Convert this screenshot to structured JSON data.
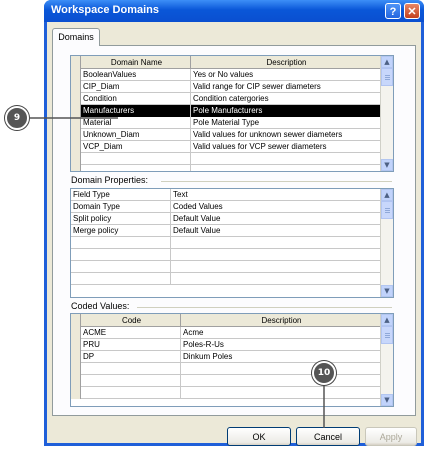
{
  "window": {
    "title": "Workspace Domains",
    "help_label": "?",
    "close_label": "✕"
  },
  "tab": {
    "label": "Domains"
  },
  "domains_grid": {
    "columns": [
      "Domain Name",
      "Description"
    ],
    "rows": [
      {
        "name": "BooleanValues",
        "description": "Yes or No values"
      },
      {
        "name": "CIP_Diam",
        "description": "Valid range for CIP sewer diameters"
      },
      {
        "name": "Condition",
        "description": "Condition catergories"
      },
      {
        "name": "Manufacturers",
        "description": "Pole Manufacturers"
      },
      {
        "name": "Material",
        "description": "Pole Material Type"
      },
      {
        "name": "Unknown_Diam",
        "description": "Valid values for unknown sewer diameters"
      },
      {
        "name": "VCP_Diam",
        "description": "Valid values for VCP sewer diameters"
      }
    ],
    "selected_index": 3
  },
  "properties": {
    "label": "Domain Properties:",
    "rows": [
      {
        "key": "Field Type",
        "value": "Text"
      },
      {
        "key": "Domain Type",
        "value": "Coded Values"
      },
      {
        "key": "Split policy",
        "value": "Default Value"
      },
      {
        "key": "Merge policy",
        "value": "Default Value"
      }
    ]
  },
  "coded_values": {
    "label": "Coded Values:",
    "columns": [
      "Code",
      "Description"
    ],
    "rows": [
      {
        "code": "ACME",
        "description": "Acme"
      },
      {
        "code": "PRU",
        "description": "Poles-R-Us"
      },
      {
        "code": "DP",
        "description": "Dinkum Poles"
      }
    ]
  },
  "buttons": {
    "ok": "OK",
    "cancel": "Cancel",
    "apply": "Apply"
  },
  "callouts": {
    "first": "9",
    "second": "10"
  },
  "colors": {
    "title_bar": "#0a57d8",
    "selection": "#000000",
    "callout": "#555555"
  }
}
